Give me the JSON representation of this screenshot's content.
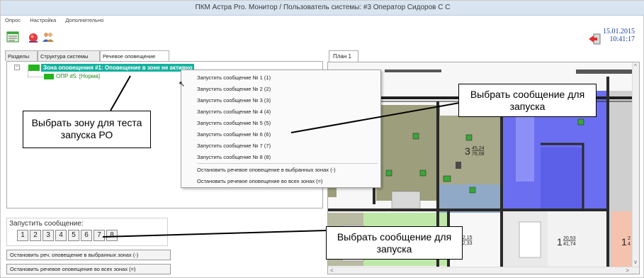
{
  "window": {
    "title": "ПКМ Астра Pro. Монитор / Пользователь системы: #3 Оператор Сидоров С С"
  },
  "menu": [
    "Опрос",
    "Настройка",
    "Дополнительно"
  ],
  "toolbar": {
    "icons": [
      "settings-window-icon",
      "alarm-light-icon",
      "users-icon",
      "exit-icon"
    ],
    "date": "15.01.2015",
    "time": "10:41:17"
  },
  "left_tabs": [
    "Разделы",
    "Структура системы",
    "Речевое оповещение"
  ],
  "tree": {
    "expander": "−",
    "zone_label": "Зона оповещения #1: Оповещение в зоне не активно",
    "child_label": "ОПР #5: [Норма]"
  },
  "context_menu": {
    "items": [
      "Запустить сообщение № 1 (1)",
      "Запустить сообщение № 2 (2)",
      "Запустить сообщение № 3 (3)",
      "Запустить сообщение № 4 (4)",
      "Запустить сообщение № 5 (5)",
      "Запустить сообщение № 6 (6)",
      "Запустить сообщение № 7 (7)",
      "Запустить сообщение № 8 (8)"
    ],
    "stop_items": [
      "Остановить речевое оповещение в выбранных зонах (-)",
      "Остановить речевое оповещение во всех зонах (=)"
    ]
  },
  "launch": {
    "title": "Запустить сообщение:",
    "buttons": [
      "1",
      "2",
      "3",
      "4",
      "5",
      "6",
      "7",
      "8"
    ],
    "stop_selected": "Остановить реч. оповещение в выбранных зонах (-)",
    "stop_all": "Остановить речевое оповещение во всех зонах (=)"
  },
  "plan": {
    "tab": "План 1",
    "rooms": [
      {
        "num": "3",
        "area_top": "45,24",
        "area_bottom": "76,08"
      },
      {
        "num": "",
        "area_top": "22,15",
        "area_bottom": "42,33"
      },
      {
        "num": "1",
        "area_top": "20,53",
        "area_bottom": "41,74"
      },
      {
        "num": "1",
        "area_top": "2",
        "area_bottom": "4"
      }
    ]
  },
  "callouts": {
    "select_zone": "Выбрать зону для теста запуска РО",
    "select_message_top": "Выбрать сообщение для запуска",
    "select_message_bottom": "Выбрать сообщение для запуска"
  },
  "colors": {
    "zone_highlight": "#15b09f",
    "stair_blue": "#6b6ef0",
    "room_green": "#bfe8a8",
    "room_salmon": "#f4c2ad",
    "kitchen_olive": "#9c9e7c"
  }
}
